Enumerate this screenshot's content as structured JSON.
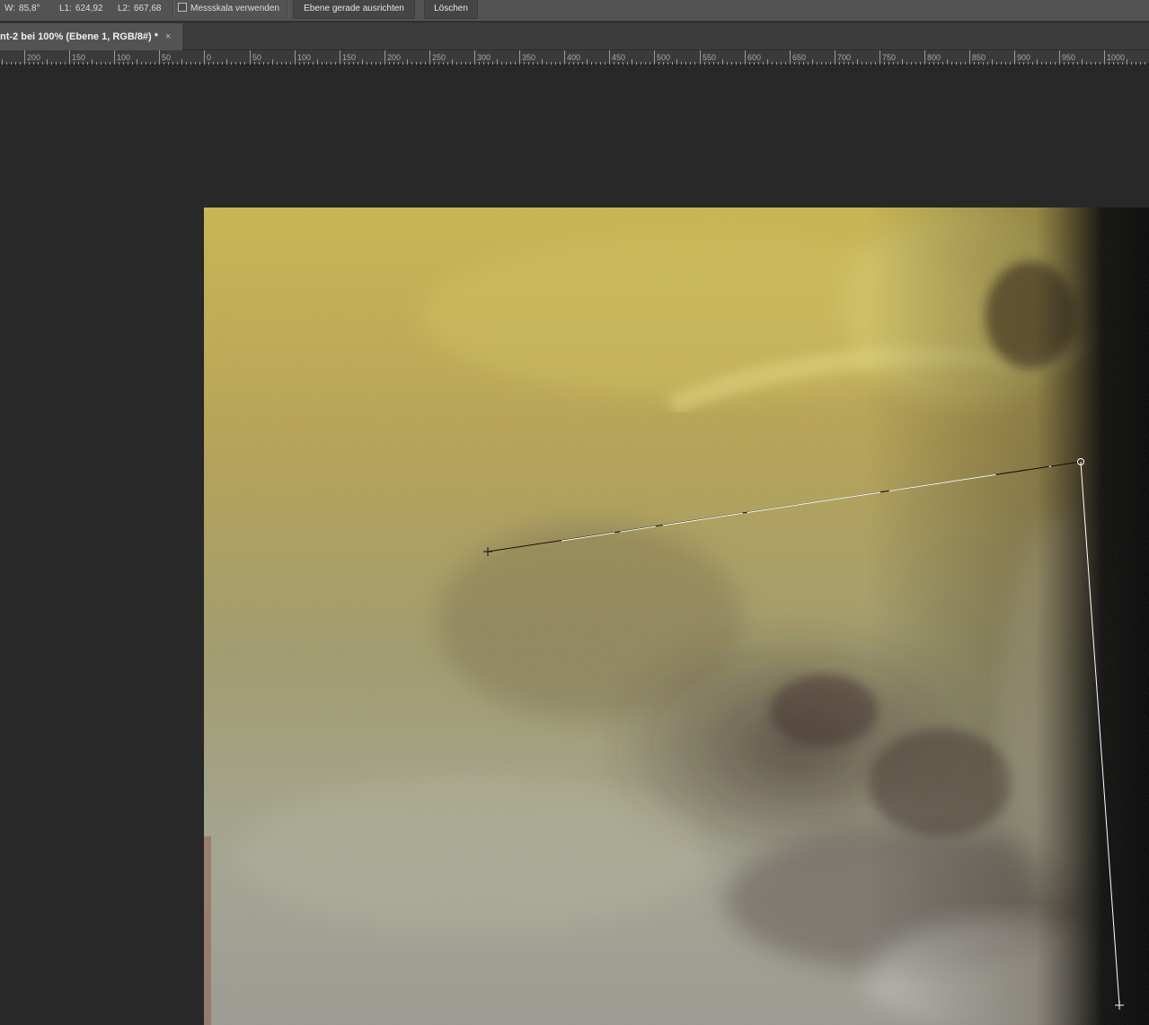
{
  "options_bar": {
    "w_label": "W:",
    "w_value": "85,8°",
    "l1_label": "L1:",
    "l1_value": "624,92",
    "l2_label": "L2:",
    "l2_value": "667,68",
    "scale_checkbox_label": "Messskala verwenden",
    "scale_checkbox_checked": false,
    "straighten_button": "Ebene gerade ausrichten",
    "delete_button": "Löschen"
  },
  "document_tab": {
    "title": "nt-2 bei 100% (Ebene 1, RGB/8#) *",
    "close_symbol": "×"
  },
  "ruler": {
    "labels": [
      "200",
      "150",
      "100",
      "50",
      "0",
      "50",
      "100",
      "150",
      "200",
      "250",
      "300",
      "350",
      "400",
      "450",
      "500",
      "550",
      "600",
      "650",
      "700",
      "750",
      "800",
      "850",
      "900",
      "950",
      "1000"
    ]
  },
  "colors": {
    "ui_dark": "#282828",
    "options_bar": "#535353",
    "measure_line": "#ffffff"
  },
  "icons": {
    "measure_origin": "crosshair-icon",
    "measure_vertex": "circle-vertex-icon",
    "measure_end": "crosshair-icon"
  }
}
